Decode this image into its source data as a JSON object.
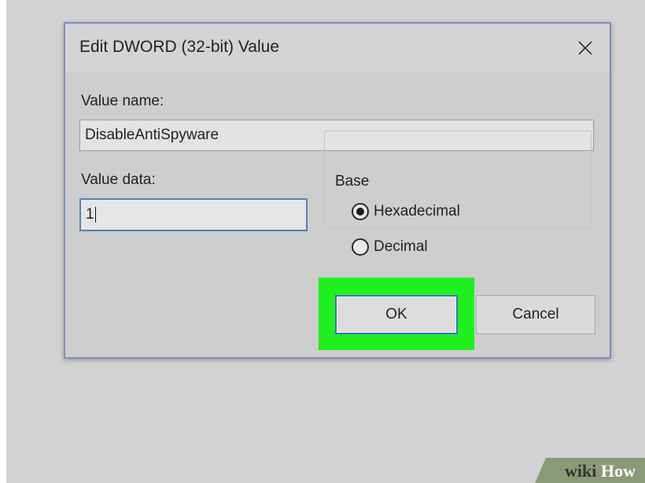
{
  "dialog": {
    "title": "Edit DWORD (32-bit) Value",
    "value_name_label": "Value name:",
    "value_name": "DisableAntiSpyware",
    "value_data_label": "Value data:",
    "value_data": "1",
    "base_label": "Base",
    "base_options": [
      {
        "label": "Hexadecimal",
        "selected": true
      },
      {
        "label": "Decimal",
        "selected": false
      }
    ],
    "ok_label": "OK",
    "cancel_label": "Cancel"
  },
  "highlight_color": "#1ff01f",
  "watermark": {
    "part1": "wiki",
    "part2": "How"
  },
  "icons": {
    "close": "close-icon"
  }
}
